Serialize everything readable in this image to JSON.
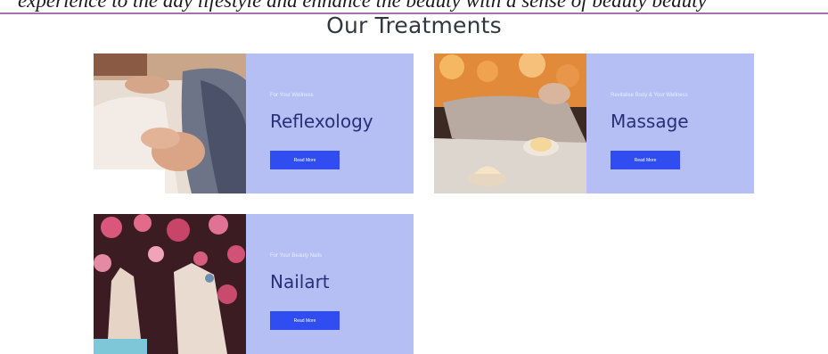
{
  "header": {
    "tagline": "experience to the day lifestyle and enhance the beauty with a sense of beauty beauty",
    "title": "Our Treatments"
  },
  "treatments": [
    {
      "eyebrow": "For Your Wellness",
      "title": "Reflexology",
      "button_label": "Read More"
    },
    {
      "eyebrow": "Revitalise Body & Your Wellness",
      "title": "Massage",
      "button_label": "Read More"
    },
    {
      "eyebrow": "For Your Beauty Nails",
      "title": "Nailart",
      "button_label": "Read More"
    }
  ],
  "colors": {
    "panel": "#b6bff3",
    "button": "#2f4df0",
    "title_text": "#28307a",
    "divider": "#a86fb0"
  }
}
